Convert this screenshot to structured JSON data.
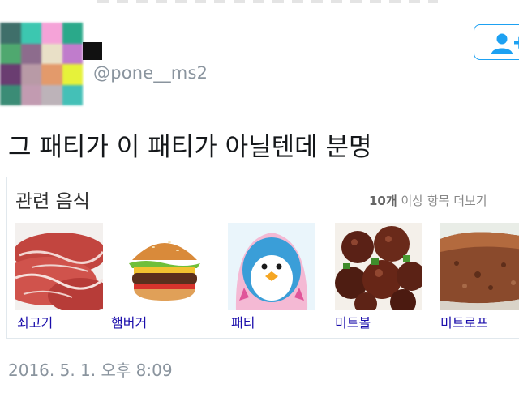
{
  "header": {
    "handle": "@pone__ms2"
  },
  "tweet": {
    "text": "그 패티가 이 패티가 아닐텐데 분명",
    "timestamp": "2016. 5. 1. 오후 8:09"
  },
  "related_card": {
    "title": "관련 음식",
    "more_count": "10개",
    "more_text": " 이상 항목 더보기",
    "items": [
      {
        "label": "쇠고기",
        "icon": "beef-image"
      },
      {
        "label": "햄버거",
        "icon": "hamburger-image"
      },
      {
        "label": "패티",
        "icon": "penguin-patty-image"
      },
      {
        "label": "미트볼",
        "icon": "meatball-image"
      },
      {
        "label": "미트로프",
        "icon": "meatloaf-image"
      }
    ]
  },
  "colors": {
    "accent": "#1da1f2",
    "link": "#1a0dab",
    "muted": "#8a949e"
  }
}
